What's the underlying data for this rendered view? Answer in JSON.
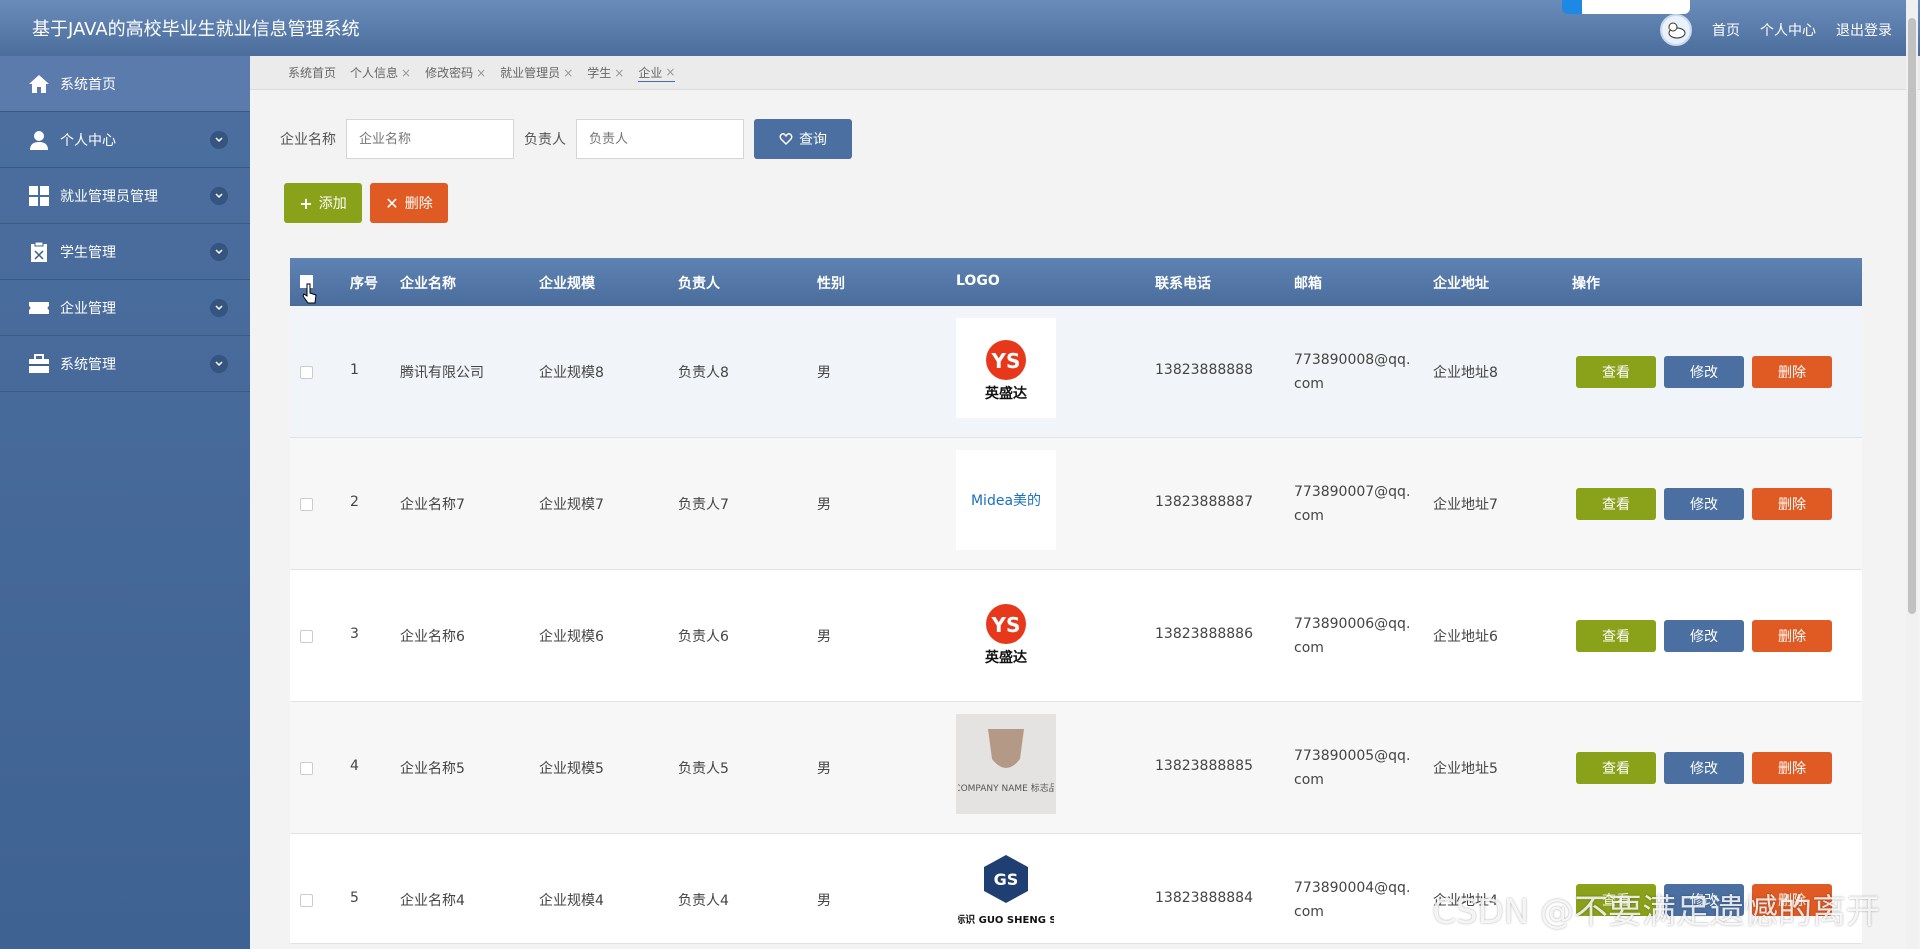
{
  "header": {
    "title": "基于JAVA的高校毕业生就业信息管理系统",
    "links": [
      "首页",
      "个人中心",
      "退出登录"
    ]
  },
  "sidebar": {
    "items": [
      {
        "label": "系统首页",
        "icon": "home-icon",
        "expandable": false
      },
      {
        "label": "个人中心",
        "icon": "user-icon",
        "expandable": true
      },
      {
        "label": "就业管理员管理",
        "icon": "grid-icon",
        "expandable": true
      },
      {
        "label": "学生管理",
        "icon": "clipboard-icon",
        "expandable": true
      },
      {
        "label": "企业管理",
        "icon": "ticket-icon",
        "expandable": true
      },
      {
        "label": "系统管理",
        "icon": "briefcase-icon",
        "expandable": true
      }
    ]
  },
  "tabs": [
    {
      "label": "系统首页",
      "closable": false
    },
    {
      "label": "个人信息",
      "closable": true
    },
    {
      "label": "修改密码",
      "closable": true
    },
    {
      "label": "就业管理员",
      "closable": true
    },
    {
      "label": "学生",
      "closable": true
    },
    {
      "label": "企业",
      "closable": true,
      "active": true
    }
  ],
  "search": {
    "company_label": "企业名称",
    "company_placeholder": "企业名称",
    "manager_label": "负责人",
    "manager_placeholder": "负责人",
    "query_label": "查询"
  },
  "actions": {
    "add_label": "添加",
    "delete_label": "删除"
  },
  "table": {
    "headers": [
      "序号",
      "企业名称",
      "企业规模",
      "负责人",
      "性别",
      "LOGO",
      "联系电话",
      "邮箱",
      "企业地址",
      "操作"
    ],
    "rows": [
      {
        "no": "1",
        "name": "腾讯有限公司",
        "scale": "企业规模8",
        "manager": "负责人8",
        "gender": "男",
        "logo": "英盛达",
        "phone": "13823888888",
        "email": "773890008@qq.com",
        "address": "企业地址8"
      },
      {
        "no": "2",
        "name": "企业名称7",
        "scale": "企业规模7",
        "manager": "负责人7",
        "gender": "男",
        "logo": "Midea美的",
        "phone": "13823888887",
        "email": "773890007@qq.com",
        "address": "企业地址7"
      },
      {
        "no": "3",
        "name": "企业名称6",
        "scale": "企业规模6",
        "manager": "负责人6",
        "gender": "男",
        "logo": "英盛达",
        "phone": "13823888886",
        "email": "773890006@qq.com",
        "address": "企业地址6"
      },
      {
        "no": "4",
        "name": "企业名称5",
        "scale": "企业规模5",
        "manager": "负责人5",
        "gender": "男",
        "logo": "COMPANY NAME 标志品",
        "phone": "13823888885",
        "email": "773890005@qq.com",
        "address": "企业地址5"
      },
      {
        "no": "5",
        "name": "企业名称4",
        "scale": "企业规模4",
        "manager": "负责人4",
        "gender": "男",
        "logo": "国圣标识 GUO SHENG SIGN",
        "phone": "13823888884",
        "email": "773890004@qq.com",
        "address": "企业地址4"
      }
    ],
    "ops": {
      "view": "查看",
      "edit": "修改",
      "delete": "删除"
    }
  },
  "watermark": "CSDN @不要满足遗憾的离开",
  "colors": {
    "header": "#4a6d9c",
    "sidebar": "#3e6292",
    "green": "#8aa11a",
    "blue": "#4a6fa0",
    "orange": "#e05a23"
  }
}
